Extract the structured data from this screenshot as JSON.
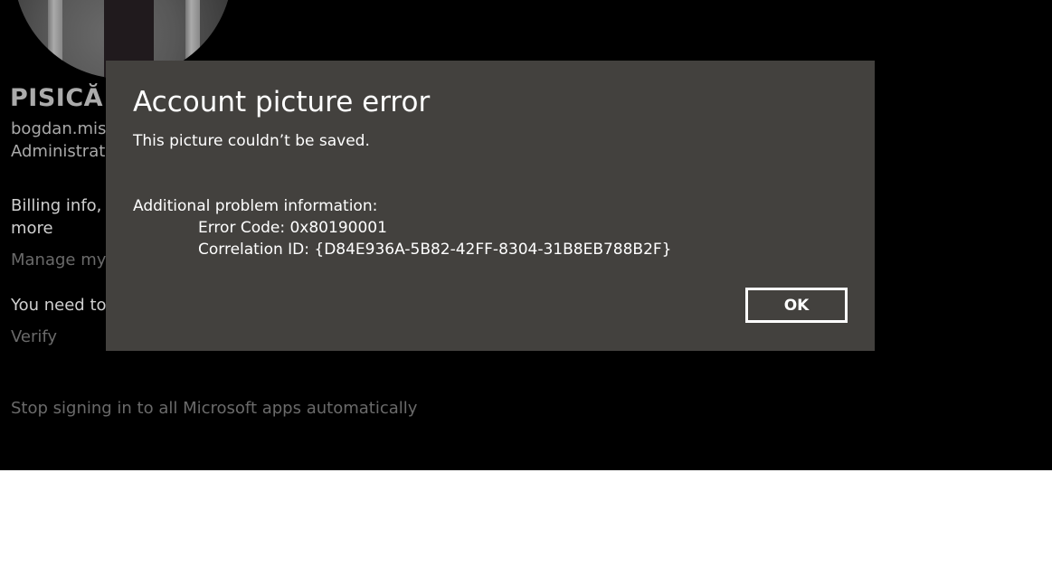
{
  "profile": {
    "name": "PISICĂ",
    "email": "bogdan.misu",
    "role": "Administrato",
    "billing_text_line1": "Billing info, fa",
    "billing_text_line2": "more",
    "manage_link": "Manage my",
    "verify_text": "You need to v",
    "verify_link": "Verify",
    "stop_signing_link": "Stop signing in to all Microsoft apps automatically"
  },
  "dialog": {
    "title": "Account picture error",
    "message": "This picture couldn’t be saved.",
    "info_heading": "Additional problem information:",
    "error_code": "Error Code: 0x80190001",
    "correlation_id": "Correlation ID: {D84E936A-5B82-42FF-8304-31B8EB788B2F}",
    "ok_label": "OK"
  },
  "colors": {
    "app_background": "#000000",
    "dialog_background": "#43413e",
    "dialog_text": "#ffffff",
    "secondary_text": "#a9a9a9",
    "link_text": "#6a6a6a"
  }
}
